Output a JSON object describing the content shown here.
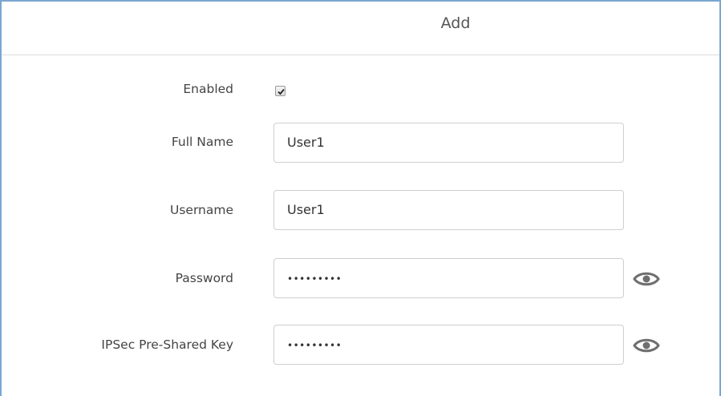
{
  "dialog": {
    "title": "Add"
  },
  "form": {
    "enabled": {
      "label": "Enabled",
      "checked": true
    },
    "full_name": {
      "label": "Full Name",
      "value": "User1"
    },
    "username": {
      "label": "Username",
      "value": "User1"
    },
    "password": {
      "label": "Password",
      "masked_value": "•••••••••",
      "toggle_icon": "eye-icon"
    },
    "ipsec_psk": {
      "label": "IPSec Pre-Shared Key",
      "masked_value": "•••••••••",
      "toggle_icon": "eye-icon"
    }
  },
  "colors": {
    "border_accent": "#7ba7d1",
    "text": "#444444",
    "input_border": "#cfcfcf",
    "icon": "#6f6f6f"
  }
}
